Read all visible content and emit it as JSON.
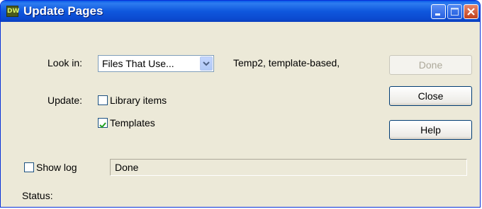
{
  "window": {
    "title": "Update Pages",
    "app_icon_text": "DW"
  },
  "form": {
    "look_in_label": "Look in:",
    "look_in_value": "Files That Use...",
    "look_in_info": "Temp2, template-based,",
    "update_label": "Update:",
    "library_items_label": "Library items",
    "library_items_checked": false,
    "templates_label": "Templates",
    "templates_checked": true,
    "show_log_label": "Show log",
    "show_log_checked": false,
    "log_text": "Done",
    "status_label": "Status:"
  },
  "buttons": {
    "done": "Done",
    "close": "Close",
    "help": "Help"
  },
  "colors": {
    "titlebar": "#0f57dd",
    "dialog_bg": "#ece9d8",
    "checkmark": "#21a121"
  }
}
